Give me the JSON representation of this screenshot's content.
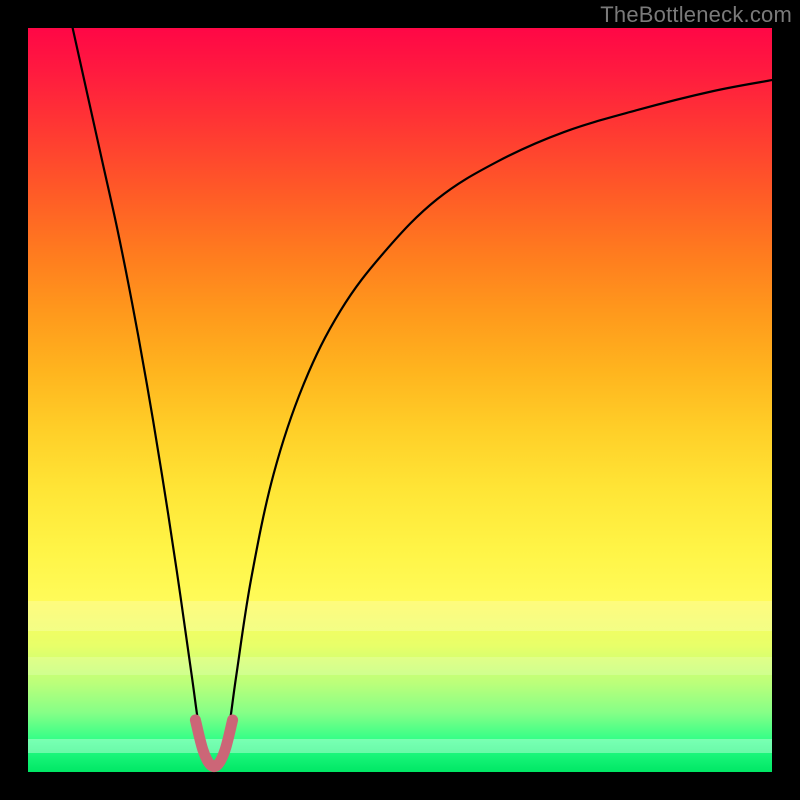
{
  "watermark": "TheBottleneck.com",
  "chart_data": {
    "type": "line",
    "title": "",
    "xlabel": "",
    "ylabel": "",
    "xlim": [
      0,
      100
    ],
    "ylim": [
      0,
      100
    ],
    "grid": false,
    "legend": null,
    "series": [
      {
        "name": "bottleneck-curve",
        "color": "#000000",
        "x": [
          6,
          8,
          10,
          12,
          14,
          16,
          18,
          20,
          22,
          23,
          24,
          25,
          26,
          27,
          28,
          30,
          33,
          37,
          42,
          48,
          55,
          63,
          72,
          82,
          92,
          100
        ],
        "y": [
          100,
          91,
          82,
          73,
          63,
          52,
          40,
          27,
          13,
          6,
          2,
          0.5,
          2,
          6,
          13,
          26,
          40,
          52,
          62,
          70,
          77,
          82,
          86,
          89,
          91.5,
          93
        ]
      },
      {
        "name": "optimal-range-highlight",
        "color": "#cc6677",
        "x": [
          22.5,
          23.5,
          24.5,
          25.5,
          26.5,
          27.5
        ],
        "y": [
          7,
          3,
          1,
          1,
          3,
          7
        ]
      }
    ],
    "background_gradient": {
      "top_color": "#ff0746",
      "bottom_color": "#00e765",
      "meaning": "higher y = worse (red), lower y = better (green)"
    },
    "curve_minimum": {
      "x": 25,
      "y": 0.5
    }
  }
}
